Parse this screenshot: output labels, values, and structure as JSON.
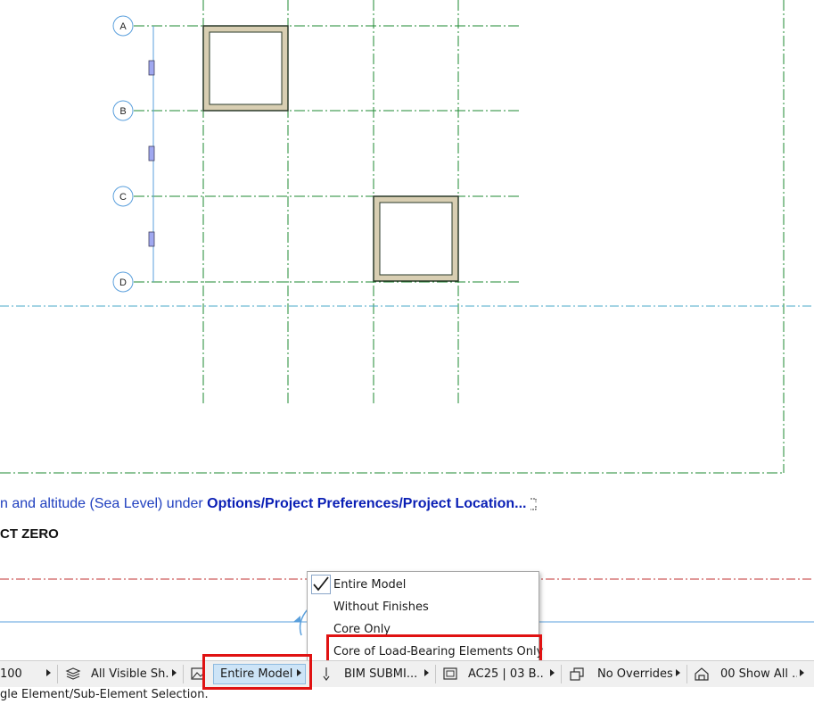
{
  "grid": {
    "axes": [
      "A",
      "B",
      "C",
      "D"
    ]
  },
  "note": {
    "prefix": "n and altitude (Sea Level) under ",
    "link": "Options/Project Preferences/Project Location..."
  },
  "zero_label": "CT ZERO",
  "menu": {
    "items": [
      {
        "label": "Entire Model",
        "checked": true
      },
      {
        "label": "Without Finishes",
        "checked": false
      },
      {
        "label": "Core Only",
        "checked": false
      },
      {
        "label": "Core of Load-Bearing Elements Only",
        "checked": false
      }
    ]
  },
  "statusbar": {
    "scale_fragment": "100",
    "layer_combo": "All Visible Sh...",
    "model_view": "Entire Model",
    "mvo": "BIM SUBMI...",
    "pen_set": "AC25 | 03 B...",
    "overrides": "No Overrides",
    "renovation": "00 Show All ..."
  },
  "hint": "gle Element/Sub-Element Selection.",
  "colors": {
    "grid_green": "#1e8a32",
    "grid_blue": "#5a9fdc",
    "link_blue": "#0a1fb5",
    "highlight_red": "#e01212",
    "wall_fill": "#d8ceb2"
  }
}
